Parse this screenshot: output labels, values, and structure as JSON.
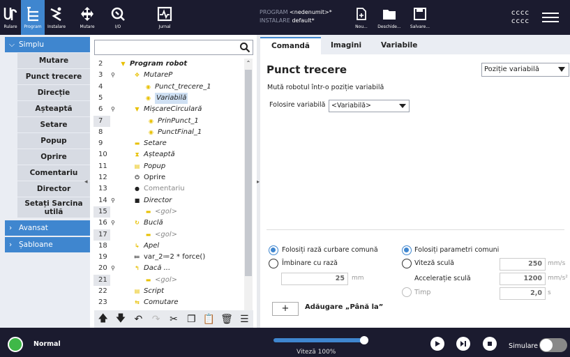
{
  "topbar": {
    "buttons": [
      {
        "label": "Rulare",
        "icon": "ur-logo-icon"
      },
      {
        "label": "Program",
        "icon": "program-icon",
        "active": true
      },
      {
        "label": "Instalare",
        "icon": "installation-icon"
      },
      {
        "label": "Mutare",
        "icon": "move-icon"
      },
      {
        "label": "I/O",
        "icon": "io-icon"
      },
      {
        "label": "Jurnal",
        "icon": "log-icon"
      }
    ],
    "program_label": "PROGRAM",
    "program_value": "<nedenumit>*",
    "installation_label": "INSTALARE",
    "installation_value": "default*",
    "file_buttons": [
      {
        "label": "Nou..."
      },
      {
        "label": "Deschide..."
      },
      {
        "label": "Salvare..."
      }
    ],
    "user_line1": "cccc",
    "user_line2": "cccc"
  },
  "sidebar": {
    "simplu": "Simplu",
    "items": [
      "Mutare",
      "Punct trecere",
      "Direcție",
      "Așteaptă",
      "Setare",
      "Popup",
      "Oprire",
      "Comentariu",
      "Director",
      "Setați Sarcina utilă"
    ],
    "avansat": "Avansat",
    "sabloane": "Șabloane"
  },
  "tree": {
    "search_placeholder": "",
    "rows": [
      {
        "ln": "2",
        "text": "Program robot",
        "icon": "▼",
        "icon_color": "#e8c000",
        "indent": 0,
        "style": "bold"
      },
      {
        "ln": "3",
        "text": "MutareP",
        "icon": "✥",
        "icon_color": "#e8c000",
        "indent": 1,
        "pin": true
      },
      {
        "ln": "4",
        "text": "Punct_trecere_1",
        "icon": "◉",
        "icon_color": "#e8c000",
        "indent": 2
      },
      {
        "ln": "5",
        "text": "Variabilă",
        "icon": "◉",
        "icon_color": "#e8c000",
        "indent": 2,
        "selected": true
      },
      {
        "ln": "6",
        "text": "MișcareCirculară",
        "icon": "▼",
        "icon_color": "#e8c000",
        "indent": 1,
        "pin": true
      },
      {
        "ln": "7",
        "text": "PrinPunct_1",
        "icon": "◉",
        "icon_color": "#e8c000",
        "indent": 3,
        "grey": true
      },
      {
        "ln": "8",
        "text": "PunctFinal_1",
        "icon": "◉",
        "icon_color": "#e8c000",
        "indent": 3
      },
      {
        "ln": "9",
        "text": "Setare",
        "icon": "▬",
        "icon_color": "#e8c000",
        "indent": 1
      },
      {
        "ln": "10",
        "text": "Așteaptă",
        "icon": "⧗",
        "icon_color": "#e8c000",
        "indent": 1
      },
      {
        "ln": "11",
        "text": "Popup",
        "icon": "▤",
        "icon_color": "#e8c000",
        "indent": 1
      },
      {
        "ln": "12",
        "text": "Oprire",
        "icon": "⏻",
        "icon_color": "#222",
        "indent": 1,
        "style": "norm"
      },
      {
        "ln": "13",
        "text": "Comentariu",
        "icon": "●",
        "icon_color": "#222",
        "indent": 1,
        "style": "greynorm"
      },
      {
        "ln": "14",
        "text": "Director",
        "icon": "■",
        "icon_color": "#222",
        "indent": 1,
        "pin": true
      },
      {
        "ln": "15",
        "text": "<gol>",
        "icon": "▬",
        "icon_color": "#e8c000",
        "indent": 2,
        "grey": true,
        "style": "grey"
      },
      {
        "ln": "16",
        "text": "Buclă",
        "icon": "↻",
        "icon_color": "#e8c000",
        "indent": 1,
        "pin": true
      },
      {
        "ln": "17",
        "text": "<gol>",
        "icon": "▬",
        "icon_color": "#e8c000",
        "indent": 2,
        "grey": true,
        "style": "grey"
      },
      {
        "ln": "18",
        "text": "Apel",
        "icon": "↳",
        "icon_color": "#e8c000",
        "indent": 1
      },
      {
        "ln": "19",
        "text": "var_2≔2 * force()",
        "icon": "≔",
        "icon_color": "#222",
        "indent": 1,
        "style": "norm"
      },
      {
        "ln": "20",
        "text": "Dacă ...",
        "icon": "↰",
        "icon_color": "#e8c000",
        "indent": 1,
        "pin": true
      },
      {
        "ln": "21",
        "text": "<gol>",
        "icon": "▬",
        "icon_color": "#e8c000",
        "indent": 2,
        "grey": true,
        "style": "grey"
      },
      {
        "ln": "22",
        "text": "Script",
        "icon": "▤",
        "icon_color": "#e8c000",
        "indent": 1
      },
      {
        "ln": "23",
        "text": "Comutare",
        "icon": "⇆",
        "icon_color": "#e8c000",
        "indent": 1
      }
    ],
    "tools": [
      "move-up-icon",
      "move-down-icon",
      "undo-icon",
      "redo-icon",
      "cut-icon",
      "copy-icon",
      "paste-icon",
      "delete-icon",
      "suppress-icon"
    ]
  },
  "tabs": [
    "Comandă",
    "Imagini",
    "Variabile"
  ],
  "panel": {
    "title": "Punct trecere",
    "type_select": "Poziție variabilă",
    "description": "Mută robotul într-o poziție variabilă",
    "var_label": "Folosire variabilă",
    "var_value": "<Variabilă>",
    "blend_common": "Folosiți rază curbare comună",
    "blend_radius": "Îmbinare cu rază",
    "blend_value": "25",
    "blend_unit": "mm",
    "use_common": "Folosiți parametri comuni",
    "tool_speed": "Viteză sculă",
    "tool_speed_value": "250",
    "tool_speed_unit": "mm/s",
    "tool_accel": "Accelerație sculă",
    "tool_accel_value": "1200",
    "tool_accel_unit": "mm/s²",
    "time": "Timp",
    "time_value": "2,0",
    "time_unit": "s",
    "add_btn": "+",
    "add_label": "Adăugare „Până la”"
  },
  "footer": {
    "status": "Normal",
    "speed": "Viteză 100%",
    "speed_fraction": 1.0,
    "sim": "Simulare"
  }
}
